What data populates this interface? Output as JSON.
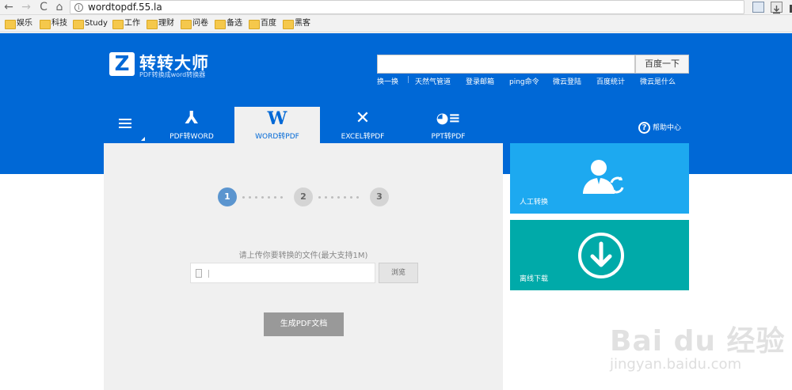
{
  "browser": {
    "url": "wordtopdf.55.la",
    "info_glyph": "i",
    "back_glyph": "←",
    "forward_glyph": "→",
    "reload_glyph": "C",
    "home_glyph": "⌂",
    "star_glyph": "☆"
  },
  "bookmarks": [
    "娱乐",
    "科技",
    "Study",
    "工作",
    "理财",
    "问卷",
    "备选",
    "百度",
    "黑客"
  ],
  "site": {
    "logo_letter": "Z",
    "title": "转转大师",
    "subtitle": "PDF转换成word转换器"
  },
  "search": {
    "value": "",
    "button_label": "百度一下"
  },
  "quick_links": [
    "换一换",
    "|",
    "天然气管道",
    "登录邮箱",
    "ping命令",
    "微云登陆",
    "百度统计",
    "微云是什么"
  ],
  "tabs": [
    {
      "glyph": "⅄",
      "label": "PDF转WORD",
      "active": false
    },
    {
      "glyph": "W",
      "label": "WORD转PDF",
      "active": true
    },
    {
      "glyph": "✕",
      "label": "EXCEL转PDF",
      "active": false
    },
    {
      "glyph": "◕≡",
      "label": "PPT转PDF",
      "active": false
    }
  ],
  "help": {
    "glyph": "?",
    "label": "帮助中心"
  },
  "steps": [
    "1",
    "2",
    "3"
  ],
  "upload": {
    "hint": "请上传你要转换的文件(最大支持1M)",
    "file_value": "",
    "browse_label": "浏览",
    "generate_label": "生成PDF文档"
  },
  "tiles": {
    "manual_label": "人工转换",
    "offline_label": "离线下载"
  },
  "watermark": {
    "logo": "Bai du 经验",
    "sub": "jingyan.baidu.com"
  },
  "colors": {
    "header": "#0068d6",
    "panel": "#f0f0f0",
    "tile_blue": "#1da9f0",
    "tile_teal": "#00aaa9",
    "step_active": "#5b95cf",
    "generate_button": "#999999"
  }
}
